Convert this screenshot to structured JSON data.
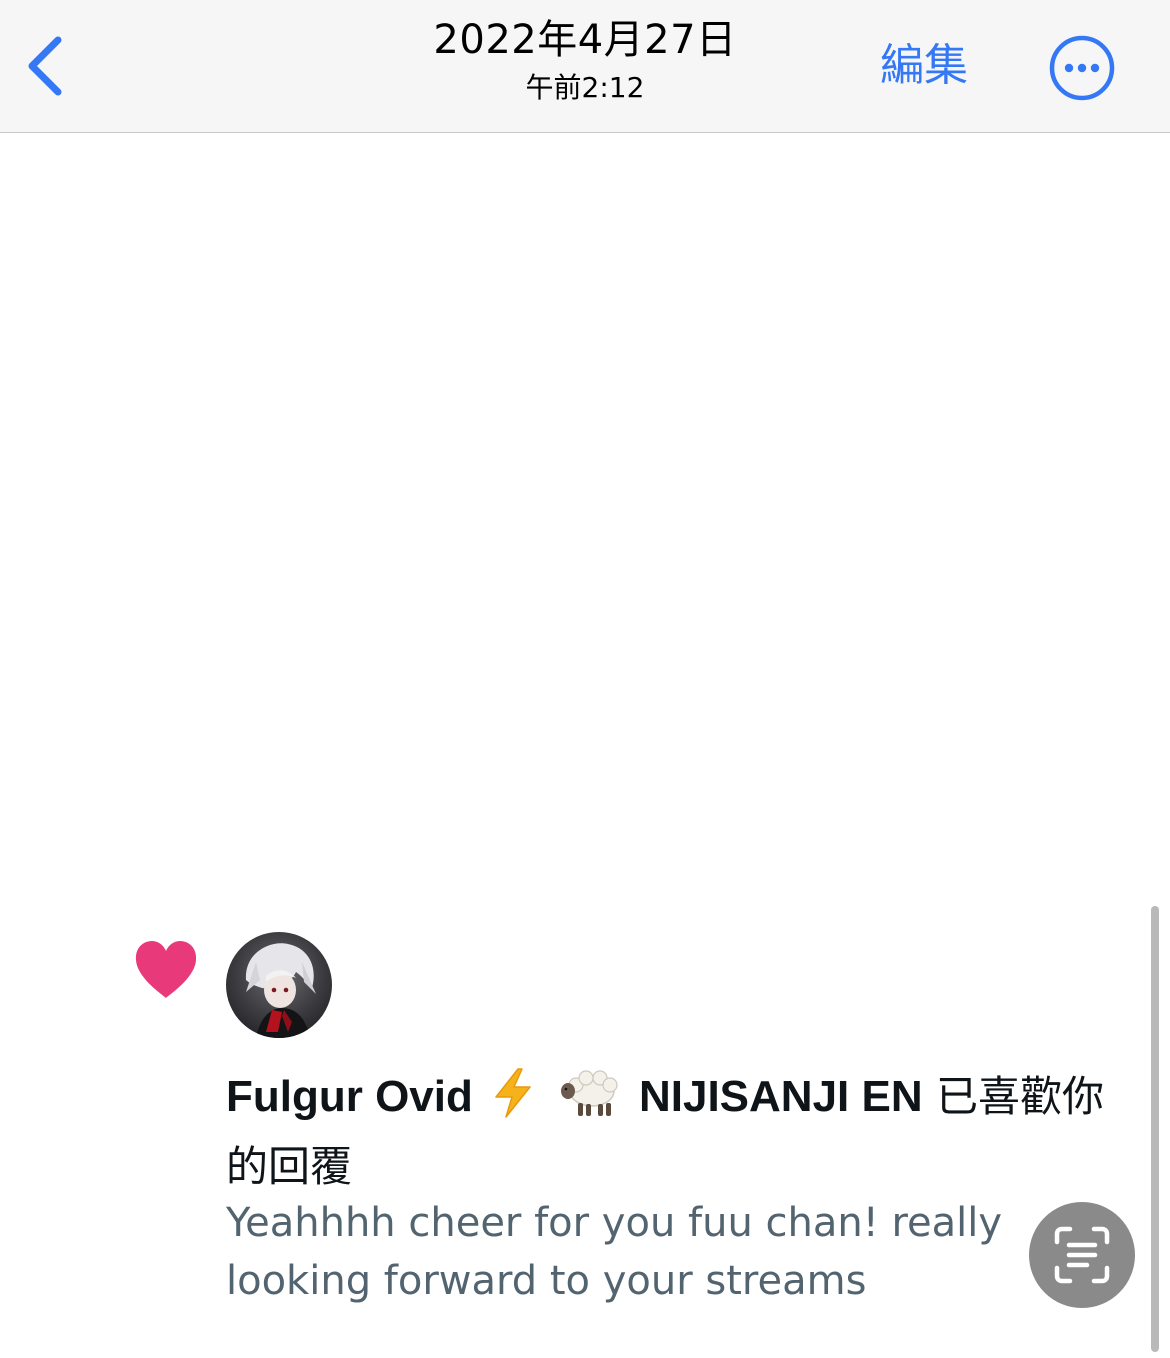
{
  "navbar": {
    "back_icon": "chevron-left-icon",
    "date": "2022年4月27日",
    "time": "午前2:12",
    "edit_label": "編集",
    "more_icon": "ellipsis-circle-icon",
    "accent_color": "#3478f6"
  },
  "notification": {
    "like_icon": "heart-icon",
    "like_color": "#e8397b",
    "avatar_icon": "user-avatar",
    "user_name": "Fulgur Ovid",
    "name_emoji_1": "⚡",
    "name_emoji_2": "🐑",
    "name_suffix": "NIJISANJI EN",
    "action_text": "已喜歡你的回覆",
    "reply_text": "Yeahhhh cheer for you fuu chan! really looking forward to your streams",
    "text_color": "#0f1419",
    "reply_color": "#536471"
  },
  "overlay": {
    "scan_icon": "live-text-scan-icon"
  }
}
